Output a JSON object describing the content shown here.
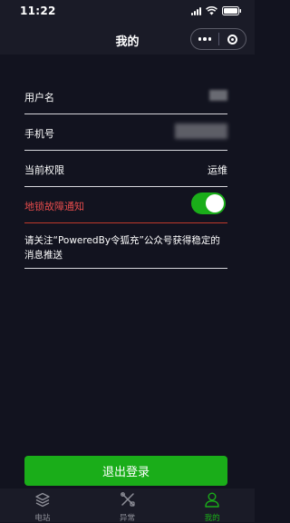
{
  "status": {
    "time": "11:22"
  },
  "nav": {
    "title": "我的"
  },
  "profile": {
    "username_label": "用户名",
    "phone_label": "手机号",
    "permission_label": "当前权限",
    "permission_value": "运维"
  },
  "notify": {
    "label": "地锁故障通知",
    "enabled": true
  },
  "notice_text": "请关注“PoweredBy令狐充”公众号获得稳定的消息推送",
  "logout_label": "退出登录",
  "tabs": [
    {
      "label": "电站",
      "icon": "layers-icon"
    },
    {
      "label": "异常",
      "icon": "tools-icon"
    },
    {
      "label": "我的",
      "icon": "user-icon"
    }
  ],
  "colors": {
    "accent": "#1aad19",
    "alert": "#e74c4c",
    "background": "#12131f"
  }
}
